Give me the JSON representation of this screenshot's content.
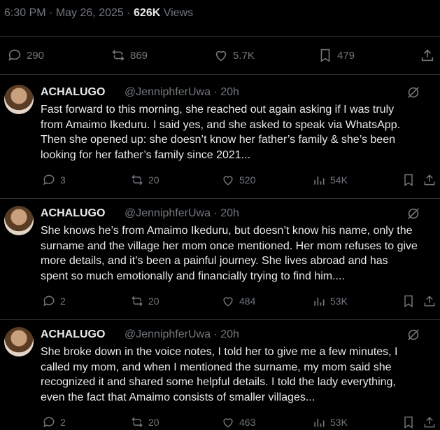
{
  "post_meta": {
    "time": "6:30 PM",
    "date": "May 26, 2025",
    "views_count": "626K",
    "views_label": "Views"
  },
  "post_actions": {
    "replies": "290",
    "reposts": "869",
    "likes": "5.7K",
    "bookmarks": "479"
  },
  "replies": [
    {
      "name": "ACHALUGO",
      "handle": "@JenniphferUwa · 20h",
      "text": "Fast forward to this morning, she reached out again asking if I was truly\nfrom Amaimo Ikeduru. I said yes, and she asked to speak via WhatsApp.\nThen she opened up: she doesn’t know her father’s family & she’s been\nlooking for her father’s family since 2021...",
      "replies": "3",
      "reposts": "20",
      "likes": "520",
      "views": "54K"
    },
    {
      "name": "ACHALUGO",
      "handle": "@JenniphferUwa · 20h",
      "text": "She knows he’s from Amaimo Ikeduru, but doesn’t know his name, only the\nsurname and the village her mom once mentioned. Her mom refuses to give\nmore details, and it’s been a painful journey. She lives abroad and has\nspent so much emotionally and financially trying to find him....",
      "replies": "2",
      "reposts": "20",
      "likes": "484",
      "views": "53K"
    },
    {
      "name": "ACHALUGO",
      "handle": "@JenniphferUwa · 20h",
      "text": "She broke down in the voice notes, I told her to give me a few minutes, I\ncalled my mom, and when I mentioned the surname, my mom said she\nrecognized it and shared some helpful details. I told the lady everything,\neven the fact that Amaimo consists of smaller villages...",
      "replies": "2",
      "reposts": "20",
      "likes": "463",
      "views": "53K"
    }
  ]
}
